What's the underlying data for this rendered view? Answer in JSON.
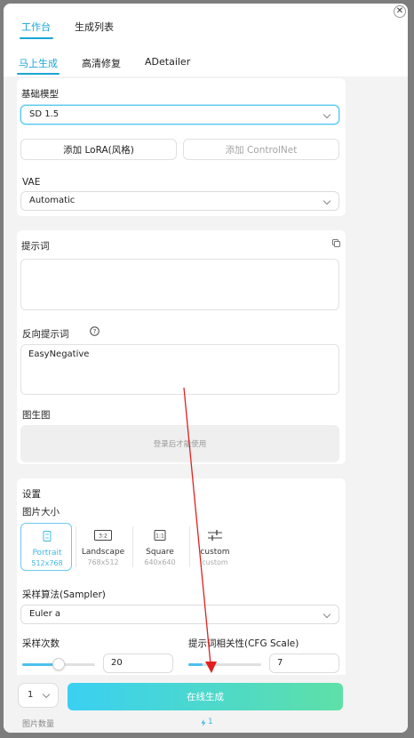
{
  "tabs": [
    {
      "label": "工作台",
      "active": true
    },
    {
      "label": "生成列表",
      "active": false
    }
  ],
  "subtabs": [
    {
      "label": "马上生成",
      "active": true
    },
    {
      "label": "高清修复",
      "active": false
    },
    {
      "label": "ADetailer",
      "active": false
    }
  ],
  "model_section": {
    "title": "基础模型",
    "model_value": "SD 1.5",
    "add_lora": "添加 LoRA(风格)",
    "add_controlnet": "添加 ControlNet",
    "vae_label": "VAE",
    "vae_value": "Automatic"
  },
  "prompt_section": {
    "title": "提示词",
    "prompt_value": "",
    "negative_label": "反向提示词",
    "negative_value": "EasyNegative",
    "img2img_label": "图生图",
    "img2img_hint": "登录后才能使用"
  },
  "settings": {
    "title": "设置",
    "size_label": "图片大小",
    "sizes": [
      {
        "name": "Portrait",
        "dims": "512x768",
        "active": true,
        "icon": "portrait-icon"
      },
      {
        "name": "Landscape",
        "dims": "768x512",
        "active": false,
        "icon": "ratio-3-2-icon",
        "glyph": "3:2"
      },
      {
        "name": "Square",
        "dims": "640x640",
        "active": false,
        "icon": "ratio-1-1-icon",
        "glyph": "1:1"
      },
      {
        "name": "custom",
        "dims": "custom",
        "active": false,
        "icon": "sliders-icon"
      }
    ],
    "sampler_label": "采样算法(Sampler)",
    "sampler_value": "Euler a",
    "steps_label": "采样次数",
    "steps_value": "20",
    "steps_fraction": 0.5,
    "cfg_label": "提示词相关性(CFG Scale)",
    "cfg_value": "7",
    "cfg_fraction": 0.2
  },
  "bottom": {
    "quantity_value": "1",
    "quantity_label": "图片数量",
    "generate_label": "在线生成",
    "cost": "1"
  },
  "colors": {
    "accent": "#1aa6d4",
    "annotation_arrow": "#e02020"
  }
}
